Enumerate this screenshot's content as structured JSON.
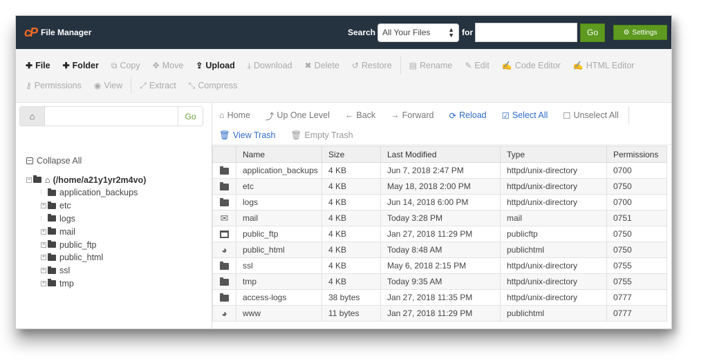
{
  "header": {
    "brand_logo": "cP",
    "title": "File Manager",
    "search_label": "Search",
    "search_scope": "All Your Files",
    "for_label": "for",
    "search_value": "",
    "go_label": "Go",
    "settings_label": "Settings",
    "accent_color": "#5d9a1f",
    "brand_color": "#f26b24"
  },
  "toolbar": {
    "row1": [
      {
        "label": "File",
        "icon": "plus-icon",
        "glyph": "✚",
        "enabled": true
      },
      {
        "label": "Folder",
        "icon": "plus-icon",
        "glyph": "✚",
        "enabled": true
      },
      {
        "label": "Copy",
        "icon": "copy-icon",
        "glyph": "⧉",
        "enabled": false
      },
      {
        "label": "Move",
        "icon": "move-icon",
        "glyph": "✥",
        "enabled": false
      },
      {
        "label": "Upload",
        "icon": "upload-icon",
        "glyph": "⇪",
        "enabled": true
      },
      {
        "label": "Download",
        "icon": "download-icon",
        "glyph": "⤓",
        "enabled": false
      },
      {
        "label": "Delete",
        "icon": "delete-icon",
        "glyph": "✖",
        "enabled": false
      },
      {
        "label": "Restore",
        "icon": "restore-icon",
        "glyph": "↺",
        "enabled": false
      },
      {
        "label": "Rename",
        "icon": "rename-icon",
        "glyph": "▤",
        "enabled": false
      },
      {
        "label": "Edit",
        "icon": "pencil-icon",
        "glyph": "✎",
        "enabled": false
      },
      {
        "label": "Code Editor",
        "icon": "code-editor-icon",
        "glyph": "✍",
        "enabled": false
      },
      {
        "label": "HTML Editor",
        "icon": "html-editor-icon",
        "glyph": "✍",
        "enabled": false
      }
    ],
    "row2": [
      {
        "label": "Permissions",
        "icon": "key-icon",
        "glyph": "⚷",
        "enabled": false
      },
      {
        "label": "View",
        "icon": "eye-icon",
        "glyph": "◉",
        "enabled": false
      },
      {
        "label": "Extract",
        "icon": "expand-icon",
        "glyph": "⤢",
        "enabled": false
      },
      {
        "label": "Compress",
        "icon": "compress-icon",
        "glyph": "⤡",
        "enabled": false
      }
    ]
  },
  "left": {
    "path_value": "",
    "go_label": "Go",
    "collapse_all_label": "Collapse All",
    "root_label": "(/home/a21y1yr2m4vo)",
    "tree": [
      {
        "label": "application_backups",
        "expandable": false
      },
      {
        "label": "etc",
        "expandable": true
      },
      {
        "label": "logs",
        "expandable": false
      },
      {
        "label": "mail",
        "expandable": true
      },
      {
        "label": "public_ftp",
        "expandable": true
      },
      {
        "label": "public_html",
        "expandable": true
      },
      {
        "label": "ssl",
        "expandable": true
      },
      {
        "label": "tmp",
        "expandable": true
      }
    ]
  },
  "nav": {
    "row1": [
      {
        "label": "Home",
        "icon": "home-icon",
        "glyph": "⌂",
        "style": "gray"
      },
      {
        "label": "Up One Level",
        "icon": "level-up-icon",
        "glyph": "⤴",
        "style": "gray"
      },
      {
        "label": "Back",
        "icon": "arrow-left-icon",
        "glyph": "←",
        "style": "gray"
      },
      {
        "label": "Forward",
        "icon": "arrow-right-icon",
        "glyph": "→",
        "style": "gray"
      },
      {
        "label": "Reload",
        "icon": "reload-icon",
        "glyph": "⟳",
        "style": "blue"
      },
      {
        "label": "Select All",
        "icon": "checkbox-checked-icon",
        "glyph": "☑",
        "style": "blue"
      },
      {
        "label": "Unselect All",
        "icon": "checkbox-empty-icon",
        "glyph": "☐",
        "style": "gray"
      }
    ],
    "row2": [
      {
        "label": "View Trash",
        "icon": "trash-icon",
        "glyph": "🗑",
        "style": "blue"
      },
      {
        "label": "Empty Trash",
        "icon": "trash-icon",
        "glyph": "🗑",
        "style": "dim"
      }
    ]
  },
  "table": {
    "columns": [
      "",
      "Name",
      "Size",
      "Last Modified",
      "Type",
      "Permissions"
    ],
    "rows": [
      {
        "icon": "folder",
        "name": "application_backups",
        "size": "4 KB",
        "modified": "Jun 7, 2018 2:47 PM",
        "type": "httpd/unix-directory",
        "perms": "0700"
      },
      {
        "icon": "folder",
        "name": "etc",
        "size": "4 KB",
        "modified": "May 18, 2018 2:00 PM",
        "type": "httpd/unix-directory",
        "perms": "0750"
      },
      {
        "icon": "folder",
        "name": "logs",
        "size": "4 KB",
        "modified": "Jun 14, 2018 6:00 PM",
        "type": "httpd/unix-directory",
        "perms": "0700"
      },
      {
        "icon": "mail",
        "name": "mail",
        "size": "4 KB",
        "modified": "Today 3:28 PM",
        "type": "mail",
        "perms": "0751"
      },
      {
        "icon": "ftp",
        "name": "public_ftp",
        "size": "4 KB",
        "modified": "Jan 27, 2018 11:29 PM",
        "type": "publicftp",
        "perms": "0750"
      },
      {
        "icon": "globe",
        "name": "public_html",
        "size": "4 KB",
        "modified": "Today 8:48 AM",
        "type": "publichtml",
        "perms": "0750"
      },
      {
        "icon": "folder",
        "name": "ssl",
        "size": "4 KB",
        "modified": "May 6, 2018 2:15 PM",
        "type": "httpd/unix-directory",
        "perms": "0755"
      },
      {
        "icon": "folder",
        "name": "tmp",
        "size": "4 KB",
        "modified": "Today 9:35 AM",
        "type": "httpd/unix-directory",
        "perms": "0755"
      },
      {
        "icon": "folder",
        "name": "access-logs",
        "size": "38 bytes",
        "modified": "Jan 27, 2018 11:35 PM",
        "type": "httpd/unix-directory",
        "perms": "0777"
      },
      {
        "icon": "globe",
        "name": "www",
        "size": "11 bytes",
        "modified": "Jan 27, 2018 11:29 PM",
        "type": "publichtml",
        "perms": "0777"
      }
    ]
  }
}
